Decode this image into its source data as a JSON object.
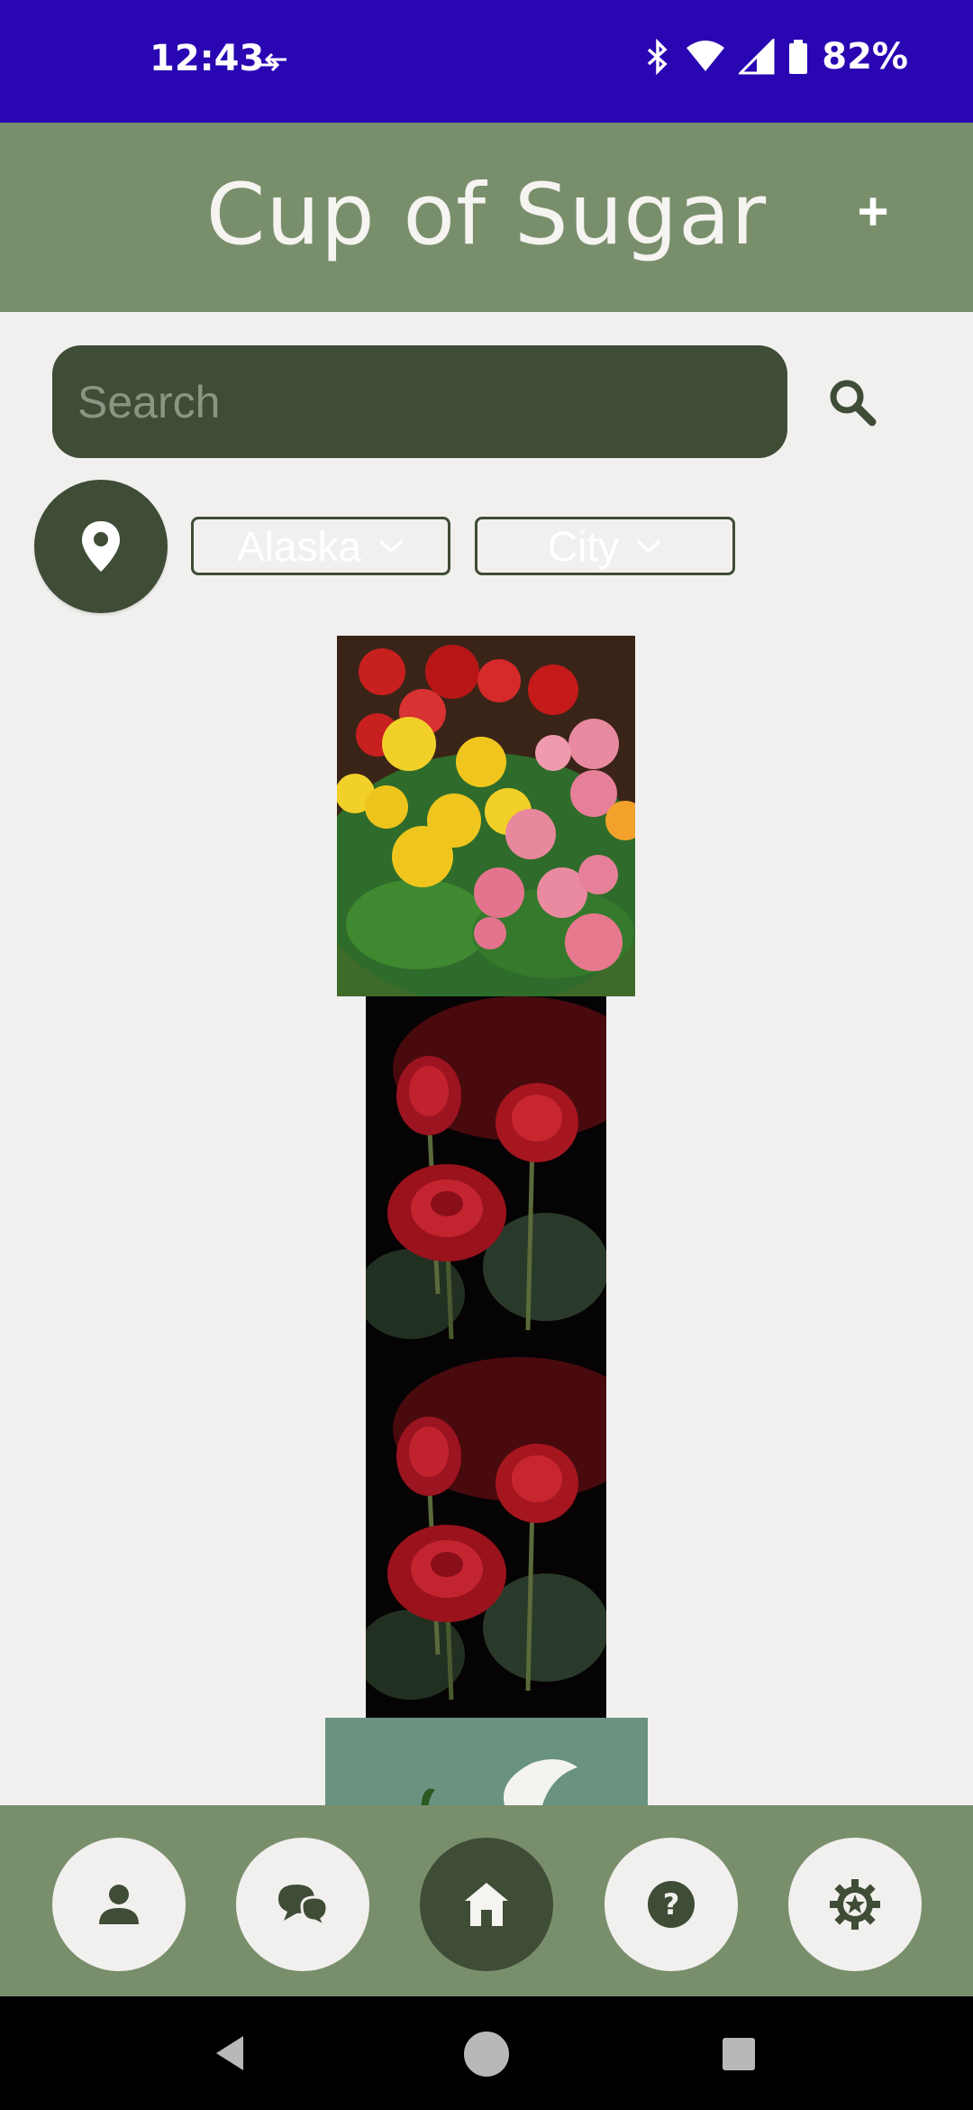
{
  "status_bar": {
    "time": "12:43",
    "battery_percent": "82%",
    "icons": [
      "data-transfer-icon",
      "bluetooth-icon",
      "wifi-icon",
      "cellular-signal-icon",
      "battery-icon"
    ]
  },
  "header": {
    "title": "Cup of Sugar",
    "add_label": "+"
  },
  "search": {
    "placeholder": "Search",
    "value": ""
  },
  "filters": {
    "state": "Alaska",
    "city": "City"
  },
  "listings": [
    {
      "subject": "begonias"
    },
    {
      "subject": "red roses"
    },
    {
      "subject": "red roses"
    },
    {
      "subject": "white calla lily"
    }
  ],
  "bottom_nav": {
    "items": [
      "profile-icon",
      "chat-icon",
      "home-icon",
      "help-icon",
      "settings-icon"
    ],
    "active": "home-icon"
  },
  "colors": {
    "status_bar": "#2a06b3",
    "header": "#798f6c",
    "accent_dark": "#3f4c36",
    "background": "#f2f0ef"
  }
}
